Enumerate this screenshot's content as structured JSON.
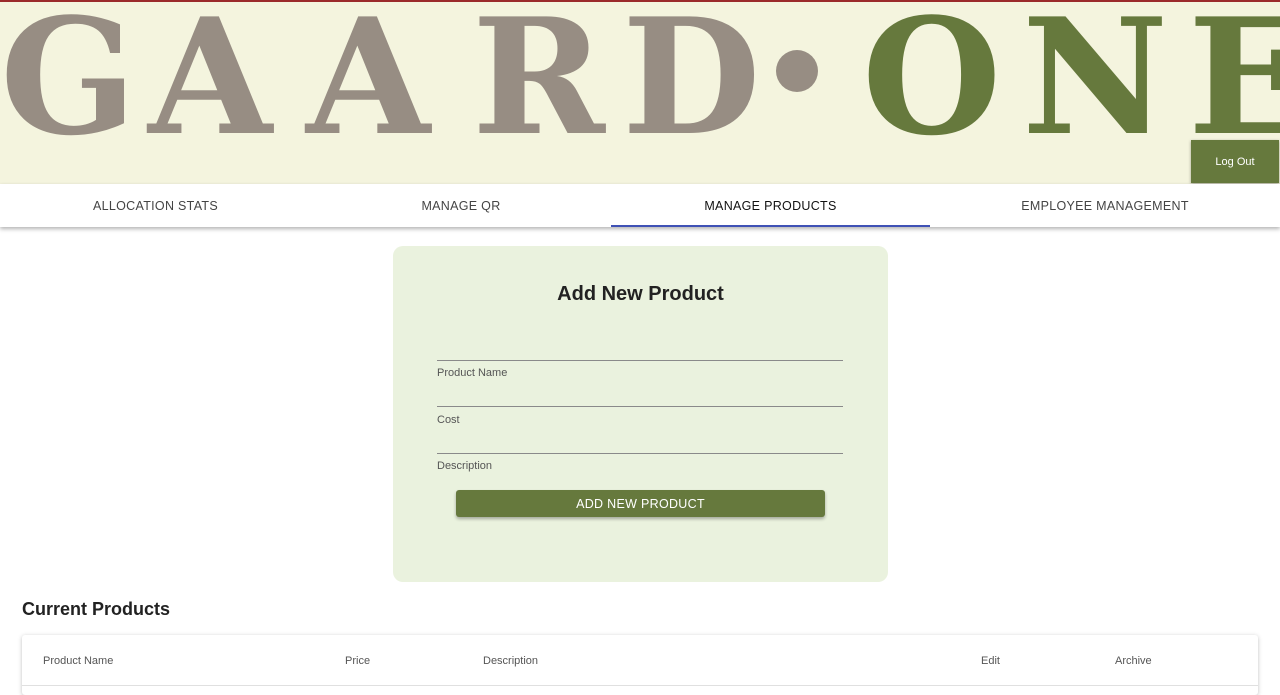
{
  "brand": {
    "letters_left": [
      "G",
      "A",
      "A",
      "R",
      "D"
    ],
    "letters_right": [
      "O",
      "N",
      "E"
    ],
    "colors": {
      "grey": "#978d83",
      "green": "#66793d",
      "banner_bg": "#f4f4de"
    }
  },
  "header": {
    "logout_label": "Log Out"
  },
  "tabs": [
    {
      "label": "ALLOCATION STATS",
      "active": false
    },
    {
      "label": "MANAGE QR",
      "active": false
    },
    {
      "label": "MANAGE PRODUCTS",
      "active": true
    },
    {
      "label": "EMPLOYEE MANAGEMENT",
      "active": false
    }
  ],
  "form": {
    "title": "Add New Product",
    "fields": [
      {
        "label": "Product Name",
        "value": ""
      },
      {
        "label": "Cost",
        "value": ""
      },
      {
        "label": "Description",
        "value": ""
      }
    ],
    "submit_label": "ADD NEW PRODUCT"
  },
  "products": {
    "title": "Current Products",
    "columns": [
      "Product Name",
      "Price",
      "Description",
      "Edit",
      "Archive"
    ]
  }
}
